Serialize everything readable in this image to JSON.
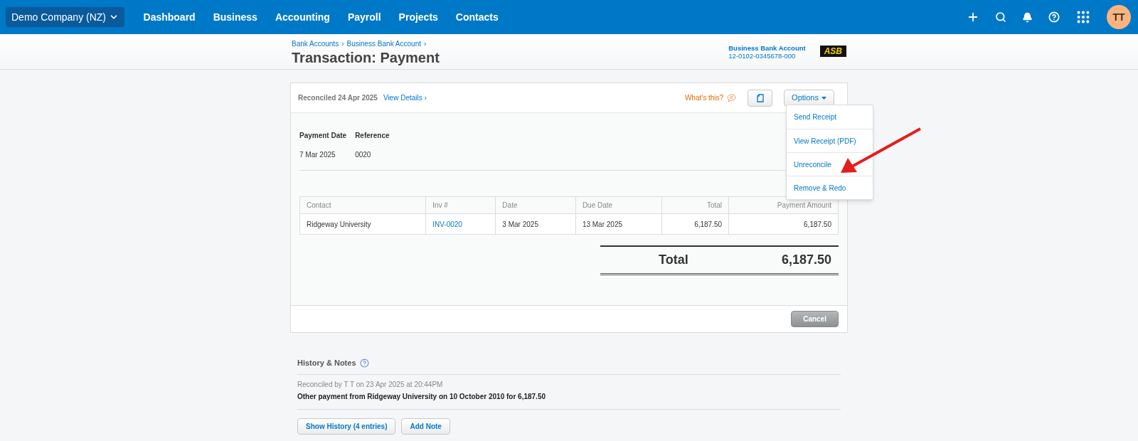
{
  "nav": {
    "org": "Demo Company (NZ)",
    "items": [
      {
        "label": "Dashboard"
      },
      {
        "label": "Business"
      },
      {
        "label": "Accounting"
      },
      {
        "label": "Payroll"
      },
      {
        "label": "Projects"
      },
      {
        "label": "Contacts"
      }
    ],
    "avatar": "TT"
  },
  "header": {
    "breadcrumbs": [
      "Bank Accounts",
      "Business Bank Account"
    ],
    "separator": "›",
    "title": "Transaction: Payment",
    "account_name": "Business Bank Account",
    "account_number": "12-0102-0345678-000",
    "bank_logo": "ASB"
  },
  "card": {
    "status": "Reconciled 24 Apr 2025",
    "view_details": "View Details ›",
    "whats_this": "What's this?",
    "options": "Options",
    "menu": [
      {
        "label": "Send Receipt"
      },
      {
        "label": "View Receipt (PDF)"
      },
      {
        "label": "Unreconcile"
      },
      {
        "label": "Remove & Redo"
      }
    ],
    "fields": [
      {
        "label": "Payment Date",
        "value": "7 Mar 2025"
      },
      {
        "label": "Reference",
        "value": "0020"
      }
    ],
    "table": {
      "columns": [
        {
          "label": "Contact",
          "kind": "text"
        },
        {
          "label": "Inv #",
          "kind": "text"
        },
        {
          "label": "Date",
          "kind": "text"
        },
        {
          "label": "Due Date",
          "kind": "text"
        },
        {
          "label": "Total",
          "kind": "number"
        },
        {
          "label": "Payment Amount",
          "kind": "number"
        }
      ],
      "rows": [
        [
          {
            "text": "Ridgeway University",
            "kind": "text"
          },
          {
            "text": "INV-0020",
            "kind": "link"
          },
          {
            "text": "3 Mar 2025",
            "kind": "text"
          },
          {
            "text": "13 Mar 2025",
            "kind": "text"
          },
          {
            "text": "6,187.50",
            "kind": "text"
          },
          {
            "text": "6,187.50",
            "kind": "text"
          }
        ]
      ]
    },
    "total_label": "Total",
    "total_value": "6,187.50",
    "cancel": "Cancel"
  },
  "history": {
    "title": "History & Notes",
    "entries": [
      {
        "meta": "Reconciled by T T on 23 Apr 2025 at 20:44PM",
        "text": "Other payment from Ridgeway University on 10 October 2010 for 6,187.50"
      }
    ],
    "buttons": [
      "Show History (4 entries)",
      "Add Note"
    ]
  }
}
